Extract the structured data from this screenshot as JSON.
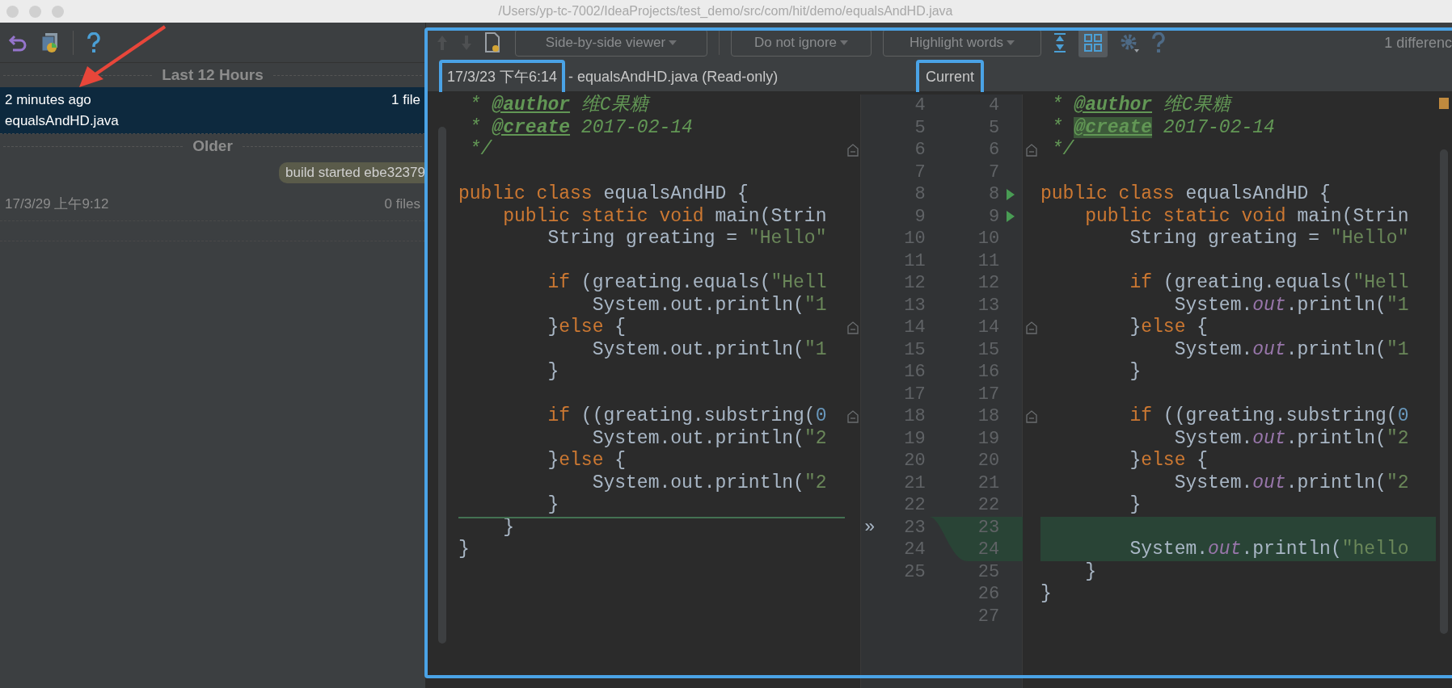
{
  "window": {
    "path": "/Users/yp-tc-7002/IdeaProjects/test_demo/src/com/hit/demo/equalsAndHD.java"
  },
  "history": {
    "groups": [
      {
        "title": "Last 12 Hours",
        "entries": [
          {
            "kind": "change",
            "time": "2 minutes ago",
            "file": "equalsAndHD.java",
            "count": "1 file",
            "selected": true
          }
        ]
      },
      {
        "title": "Older",
        "entries": [
          {
            "kind": "label",
            "text": "build started ebe32379"
          },
          {
            "kind": "change",
            "time": "17/3/29 上午9:12",
            "count": "0 files",
            "selected": false
          }
        ]
      }
    ]
  },
  "toolbar": {
    "viewer": "Side-by-side viewer",
    "ignore": "Do not ignore",
    "highlight": "Highlight words",
    "differences": "1 differenc"
  },
  "diff": {
    "left_date": "17/3/23 下午6:14",
    "left_title": "- equalsAndHD.java (Read-only)",
    "right_title": "Current",
    "left_lines": [
      {
        "number": "4",
        "tokens": [
          {
            "kind": "cmt",
            "text": " * "
          },
          {
            "kind": "tag",
            "text": "@author"
          },
          {
            "kind": "cmt",
            "text": " 维C果糖"
          }
        ]
      },
      {
        "number": "5",
        "tokens": [
          {
            "kind": "cmt",
            "text": " * "
          },
          {
            "kind": "tag",
            "text": "@create"
          },
          {
            "kind": "cmt",
            "text": " 2017-02-14"
          }
        ]
      },
      {
        "number": "6",
        "fold": true,
        "tokens": [
          {
            "kind": "cmt",
            "text": " */"
          }
        ]
      },
      {
        "number": "7"
      },
      {
        "number": "8",
        "tokens": [
          {
            "kind": "kw",
            "text": "public class "
          },
          {
            "kind": "plain",
            "text": "equalsAndHD {"
          }
        ]
      },
      {
        "number": "9",
        "tokens": [
          {
            "kind": "kw",
            "text": "    public static void "
          },
          {
            "kind": "plain",
            "text": "main(Strin"
          }
        ]
      },
      {
        "number": "10",
        "tokens": [
          {
            "kind": "plain",
            "text": "        String greating = "
          },
          {
            "kind": "str",
            "text": "\"Hello\""
          }
        ]
      },
      {
        "number": "11"
      },
      {
        "number": "12",
        "tokens": [
          {
            "kind": "kw",
            "text": "        if "
          },
          {
            "kind": "plain",
            "text": "(greating.equals("
          },
          {
            "kind": "str",
            "text": "\"Hell"
          }
        ]
      },
      {
        "number": "13",
        "tokens": [
          {
            "kind": "plain",
            "text": "            System.out.println("
          },
          {
            "kind": "str",
            "text": "\"1"
          }
        ]
      },
      {
        "number": "14",
        "fold": true,
        "tokens": [
          {
            "kind": "plain",
            "text": "        }"
          },
          {
            "kind": "kw",
            "text": "else "
          },
          {
            "kind": "plain",
            "text": "{"
          }
        ]
      },
      {
        "number": "15",
        "tokens": [
          {
            "kind": "plain",
            "text": "            System.out.println("
          },
          {
            "kind": "str",
            "text": "\"1"
          }
        ]
      },
      {
        "number": "16",
        "tokens": [
          {
            "kind": "plain",
            "text": "        }"
          }
        ]
      },
      {
        "number": "17"
      },
      {
        "number": "18",
        "fold": true,
        "tokens": [
          {
            "kind": "kw",
            "text": "        if "
          },
          {
            "kind": "plain",
            "text": "((greating.substring("
          },
          {
            "kind": "num",
            "text": "0"
          }
        ]
      },
      {
        "number": "19",
        "tokens": [
          {
            "kind": "plain",
            "text": "            System.out.println("
          },
          {
            "kind": "str",
            "text": "\"2"
          }
        ]
      },
      {
        "number": "20",
        "tokens": [
          {
            "kind": "plain",
            "text": "        }"
          },
          {
            "kind": "kw",
            "text": "else "
          },
          {
            "kind": "plain",
            "text": "{"
          }
        ]
      },
      {
        "number": "21",
        "tokens": [
          {
            "kind": "plain",
            "text": "            System.out.println("
          },
          {
            "kind": "str",
            "text": "\"2"
          }
        ]
      },
      {
        "number": "22",
        "tokens": [
          {
            "kind": "plain",
            "text": "        }"
          }
        ]
      },
      {
        "number": "23",
        "marker": "»",
        "insertion_point": true,
        "tokens": [
          {
            "kind": "plain",
            "text": "    }"
          }
        ]
      },
      {
        "number": "24",
        "tokens": [
          {
            "kind": "plain",
            "text": "}"
          }
        ]
      },
      {
        "number": "25"
      }
    ],
    "right_lines": [
      {
        "number": "4",
        "tokens": [
          {
            "kind": "cmt",
            "text": " * "
          },
          {
            "kind": "tag",
            "text": "@author"
          },
          {
            "kind": "cmt",
            "text": " 维C果糖"
          }
        ]
      },
      {
        "number": "5",
        "tokens": [
          {
            "kind": "cmt",
            "text": " * "
          },
          {
            "kind": "tag_changed",
            "text": "@create"
          },
          {
            "kind": "cmt",
            "text": " 2017-02-14"
          }
        ]
      },
      {
        "number": "6",
        "fold": true,
        "tokens": [
          {
            "kind": "cmt",
            "text": " */"
          }
        ]
      },
      {
        "number": "7"
      },
      {
        "number": "8",
        "runnable": true,
        "tokens": [
          {
            "kind": "kw",
            "text": "public class "
          },
          {
            "kind": "plain",
            "text": "equalsAndHD {"
          }
        ]
      },
      {
        "number": "9",
        "runnable": true,
        "tokens": [
          {
            "kind": "kw",
            "text": "    public static void "
          },
          {
            "kind": "plain",
            "text": "main(Strin"
          }
        ]
      },
      {
        "number": "10",
        "tokens": [
          {
            "kind": "plain",
            "text": "        String greating = "
          },
          {
            "kind": "str",
            "text": "\"Hello\""
          }
        ]
      },
      {
        "number": "11"
      },
      {
        "number": "12",
        "tokens": [
          {
            "kind": "kw",
            "text": "        if "
          },
          {
            "kind": "plain",
            "text": "(greating.equals("
          },
          {
            "kind": "str",
            "text": "\"Hell"
          }
        ]
      },
      {
        "number": "13",
        "tokens": [
          {
            "kind": "plain",
            "text": "            System."
          },
          {
            "kind": "field",
            "text": "out"
          },
          {
            "kind": "plain",
            "text": ".println("
          },
          {
            "kind": "str",
            "text": "\"1"
          }
        ]
      },
      {
        "number": "14",
        "fold": true,
        "tokens": [
          {
            "kind": "plain",
            "text": "        }"
          },
          {
            "kind": "kw",
            "text": "else "
          },
          {
            "kind": "plain",
            "text": "{"
          }
        ]
      },
      {
        "number": "15",
        "tokens": [
          {
            "kind": "plain",
            "text": "            System."
          },
          {
            "kind": "field",
            "text": "out"
          },
          {
            "kind": "plain",
            "text": ".println("
          },
          {
            "kind": "str",
            "text": "\"1"
          }
        ]
      },
      {
        "number": "16",
        "tokens": [
          {
            "kind": "plain",
            "text": "        }"
          }
        ]
      },
      {
        "number": "17"
      },
      {
        "number": "18",
        "fold": true,
        "tokens": [
          {
            "kind": "kw",
            "text": "        if "
          },
          {
            "kind": "plain",
            "text": "((greating.substring("
          },
          {
            "kind": "num",
            "text": "0"
          }
        ]
      },
      {
        "number": "19",
        "tokens": [
          {
            "kind": "plain",
            "text": "            System."
          },
          {
            "kind": "field",
            "text": "out"
          },
          {
            "kind": "plain",
            "text": ".println("
          },
          {
            "kind": "str",
            "text": "\"2"
          }
        ]
      },
      {
        "number": "20",
        "tokens": [
          {
            "kind": "plain",
            "text": "        }"
          },
          {
            "kind": "kw",
            "text": "else "
          },
          {
            "kind": "plain",
            "text": "{"
          }
        ]
      },
      {
        "number": "21",
        "tokens": [
          {
            "kind": "plain",
            "text": "            System."
          },
          {
            "kind": "field",
            "text": "out"
          },
          {
            "kind": "plain",
            "text": ".println("
          },
          {
            "kind": "str",
            "text": "\"2"
          }
        ]
      },
      {
        "number": "22",
        "tokens": [
          {
            "kind": "plain",
            "text": "        }"
          }
        ]
      },
      {
        "number": "23",
        "changed": true
      },
      {
        "number": "24",
        "changed": true,
        "tokens": [
          {
            "kind": "plain",
            "text": "        System."
          },
          {
            "kind": "field",
            "text": "out"
          },
          {
            "kind": "plain",
            "text": ".println("
          },
          {
            "kind": "str",
            "text": "\"hello"
          }
        ]
      },
      {
        "number": "25",
        "tokens": [
          {
            "kind": "plain",
            "text": "    }"
          }
        ]
      },
      {
        "number": "26",
        "tokens": [
          {
            "kind": "plain",
            "text": "}"
          }
        ]
      },
      {
        "number": "27"
      }
    ]
  }
}
